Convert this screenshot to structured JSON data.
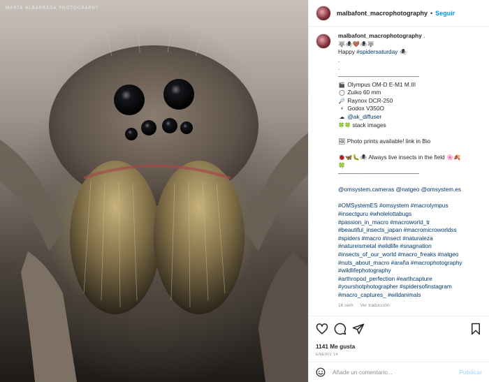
{
  "photo": {
    "watermark": "MARTA ALBARREDA PHOTOGRAPHY",
    "alt_subject": "macro wolf spider"
  },
  "header": {
    "username": "malbafont_macrophotography",
    "separator": "•",
    "follow_label": "Seguir"
  },
  "caption": {
    "username": "malbafont_macrophotography",
    "username_suffix": " .",
    "lines": [
      "🐺🕷🤎🕷🐺",
      "Happy ",
      ".",
      ".",
      "——————————————"
    ],
    "happy_tag": "#spidersaturday",
    "happy_suffix": " 🕷",
    "gear": [
      {
        "icon": "🎬",
        "text": "Olympus OM-D E-M1 M.III"
      },
      {
        "icon": "◯",
        "text": "Zuiko 60 mm"
      },
      {
        "icon": "🔎",
        "text": "Raynox DCR-250"
      },
      {
        "icon": "⚡",
        "text": "Godox V350O"
      },
      {
        "icon": "☁",
        "text": "@ak_diffuser"
      },
      {
        "icon": "🍀🍀",
        "text": "stack images"
      }
    ],
    "prints": "🖼 Photo prints available! link in Bio",
    "live_line1": "🐞🦋🐛🕷 Always live insects in the field 🌸🍂",
    "live_line2": "🍀",
    "divider": "——————————————",
    "mentions": "@omsystem.cameras @natgeo @omsystem.es",
    "hashtags": [
      "#OMSystemES #omsystem #macrolympus",
      "#insectguru #wholelottabugs",
      "#passion_in_macro #macroworld_tr",
      "#beautiful_insects_japan #macromicroworldss",
      "#spiders #macro #insect #naturaleza",
      "#natureismetal #wildlife #snagnation",
      "#insects_of_our_world #macro_freaks #natgeo",
      "#nuts_about_macro #araña #macrophotography",
      "#wildlifephotography",
      "#arthropod_perfection #earthcapture",
      "#yourshotphotographer #spidersofinstagram",
      "#macro_captures_ #wildanimals"
    ],
    "age": "16 sem",
    "translate": "Ver traducción"
  },
  "actions": {
    "likes": "1141 Me gusta",
    "date": "ENERO 14"
  },
  "comment": {
    "placeholder": "Añade un comentario...",
    "publish_label": "Publicar"
  },
  "colors": {
    "link": "#00376b",
    "follow": "#0095f6",
    "publish_disabled": "#b2dffc",
    "muted": "#8e8e8e"
  }
}
